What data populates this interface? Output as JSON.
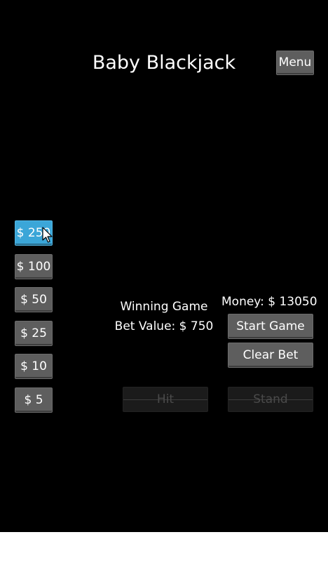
{
  "app": {
    "title": "Baby Blackjack"
  },
  "header": {
    "menu_label": "Menu"
  },
  "chips": [
    {
      "label": "$ 250",
      "selected": true
    },
    {
      "label": "$ 100",
      "selected": false
    },
    {
      "label": "$ 50",
      "selected": false
    },
    {
      "label": "$ 25",
      "selected": false
    },
    {
      "label": "$ 10",
      "selected": false
    },
    {
      "label": "$ 5",
      "selected": false
    }
  ],
  "status": {
    "game_state": "Winning Game",
    "bet_value": "Bet Value: $ 750",
    "money": "Money: $ 13050"
  },
  "actions": {
    "start_label": "Start Game",
    "clear_label": "Clear Bet",
    "hit_label": "Hit",
    "stand_label": "Stand"
  },
  "colors": {
    "background": "#000000",
    "button": "#5e5e5e",
    "selected_chip": "#3ba6d8",
    "disabled_button": "#1b1b1b"
  },
  "icons": {
    "cursor": "mouse-pointer-icon"
  }
}
